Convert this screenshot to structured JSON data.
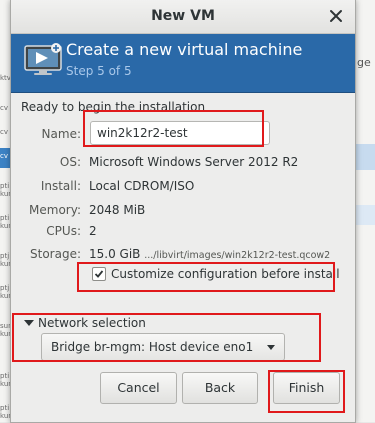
{
  "background": {
    "left_fragments": [
      "ktv",
      "cv",
      "cv",
      "cv",
      "pti",
      "kun",
      "pti",
      "kun",
      "ptj",
      "kun",
      "ptj",
      "kun",
      "sun",
      "kun",
      "pti",
      "kun",
      "pti",
      "kun"
    ],
    "right_fragment": "ge"
  },
  "dialog": {
    "title": "New VM",
    "banner": {
      "title": "Create a new virtual machine",
      "subtitle": "Step 5 of 5"
    },
    "ready_text": "Ready to begin the installation",
    "fields": {
      "name_label": "Name:",
      "name_value": "win2k12r2-test",
      "os_label": "OS:",
      "os_value": "Microsoft Windows Server 2012 R2",
      "install_label": "Install:",
      "install_value": "Local CDROM/ISO",
      "memory_label": "Memory:",
      "memory_value": "2048 MiB",
      "cpus_label": "CPUs:",
      "cpus_value": "2",
      "storage_label": "Storage:",
      "storage_value": "15.0 GiB",
      "storage_path": ".../libvirt/images/win2k12r2-test.qcow2"
    },
    "customize": {
      "label": "Customize configuration before install",
      "checked": true
    },
    "network": {
      "expander_label": "Network selection",
      "selected": "Bridge br-mgm: Host device eno1"
    },
    "buttons": {
      "cancel": "Cancel",
      "back": "Back",
      "finish": "Finish"
    },
    "colors": {
      "banner": "#2a69a8",
      "highlight": "#e0191b"
    },
    "icons": {
      "banner": "vm-monitor-icon",
      "close": "close-icon",
      "check": "checkmark-icon",
      "expander": "expander-arrow-icon",
      "dropdown": "dropdown-caret-icon"
    }
  }
}
